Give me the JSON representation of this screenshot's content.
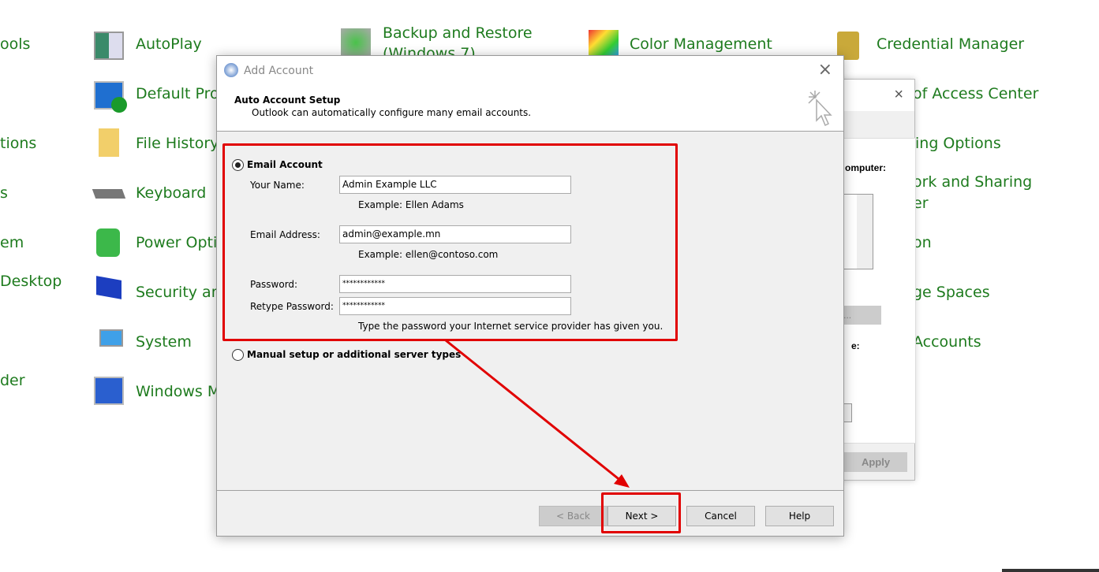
{
  "control_panel": {
    "items": [
      {
        "label": "ools",
        "icon": "admin-tools-icon"
      },
      {
        "label": "tions",
        "icon": "none"
      },
      {
        "label": "s",
        "icon": "none"
      },
      {
        "label": "em",
        "icon": "none"
      },
      {
        "label": " Desktop",
        "icon": "none"
      },
      {
        "label": "der",
        "icon": "none"
      },
      {
        "label": "AutoPlay",
        "icon": "autoplay-icon"
      },
      {
        "label": "Default Prog",
        "icon": "default-programs-icon"
      },
      {
        "label": "File History",
        "icon": "file-history-icon"
      },
      {
        "label": "Keyboard",
        "icon": "keyboard-icon"
      },
      {
        "label": "Power Optic",
        "icon": "power-options-icon"
      },
      {
        "label": "Security and",
        "icon": "flag-icon"
      },
      {
        "label": "System",
        "icon": "system-icon"
      },
      {
        "label": "Windows M",
        "icon": "windows-mobility-icon"
      },
      {
        "label": "Backup and Restore",
        "icon": "backup-icon"
      },
      {
        "label": "(Windows 7)",
        "icon": "none"
      },
      {
        "label": "Color Management",
        "icon": "color-management-icon"
      },
      {
        "label": "Credential Manager",
        "icon": "credential-manager-icon"
      },
      {
        "label": "of Access Center",
        "icon": "none"
      },
      {
        "label": "ing Options",
        "icon": "none"
      },
      {
        "label": "ork and Sharing",
        "icon": "none"
      },
      {
        "label": "er",
        "icon": "none"
      },
      {
        "label": "on",
        "icon": "none"
      },
      {
        "label": "ge Spaces",
        "icon": "none"
      },
      {
        "label": "Accounts",
        "icon": "none"
      }
    ]
  },
  "bg_dialog": {
    "label1": "omputer:",
    "label2": "e:",
    "btn1": "y...",
    "apply": "Apply"
  },
  "dialog": {
    "title": "Add Account",
    "header_title": "Auto Account Setup",
    "header_subtitle": "Outlook can automatically configure many email accounts.",
    "email_option": "Email Account",
    "email_selected": true,
    "name_label": "Your Name:",
    "name_value": "Admin Example LLC",
    "name_example": "Example: Ellen Adams",
    "email_label": "Email Address:",
    "email_value": "admin@example.mn",
    "email_example": "Example: ellen@contoso.com",
    "password_label": "Password:",
    "password_value": "************",
    "retype_label": "Retype Password:",
    "retype_value": "************",
    "password_hint": "Type the password your Internet service provider has given you.",
    "manual_option": "Manual setup or additional server types",
    "back": "< Back",
    "next": "Next >",
    "cancel": "Cancel",
    "help": "Help"
  },
  "colors": {
    "annotation": "#e10000",
    "link": "#1e7b1e"
  }
}
